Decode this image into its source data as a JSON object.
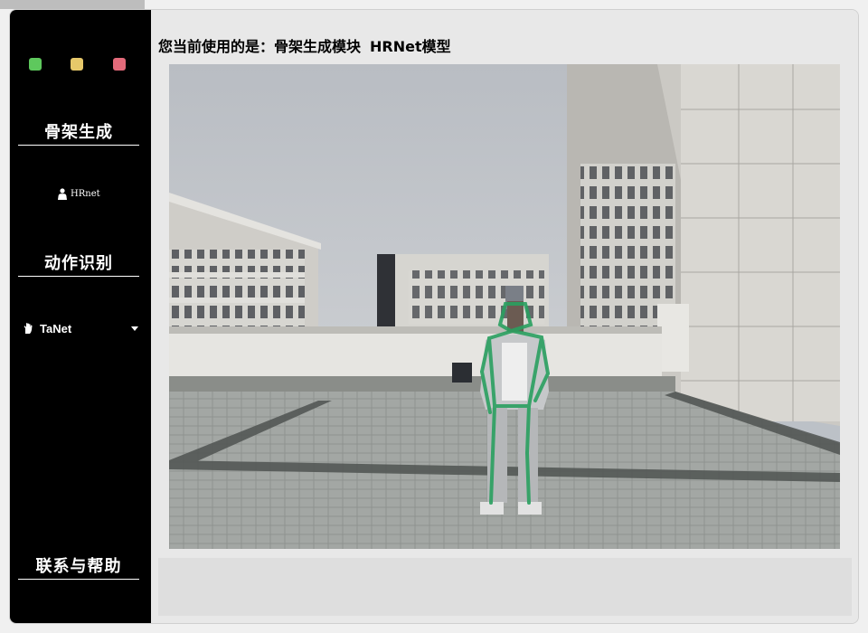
{
  "window": {
    "traffic_lights": [
      "green",
      "yellow",
      "red"
    ],
    "colors": {
      "green": "#5ec85d",
      "yellow": "#e6c86a",
      "red": "#e36a7a"
    }
  },
  "sidebar": {
    "skeleton_section": {
      "title": "骨架生成",
      "items": [
        {
          "label": "HRnet",
          "icon": "person-icon"
        }
      ]
    },
    "action_section": {
      "title": "动作识别",
      "items": [
        {
          "label": "TaNet",
          "icon": "hand-icon",
          "dropdown": true
        }
      ]
    },
    "help_section": {
      "title": "联系与帮助"
    }
  },
  "main": {
    "heading_prefix": "您当前使用的是：骨架生成模块",
    "heading_model": "HRNet模型",
    "video": {
      "skeleton_color": "#2aa060"
    }
  }
}
